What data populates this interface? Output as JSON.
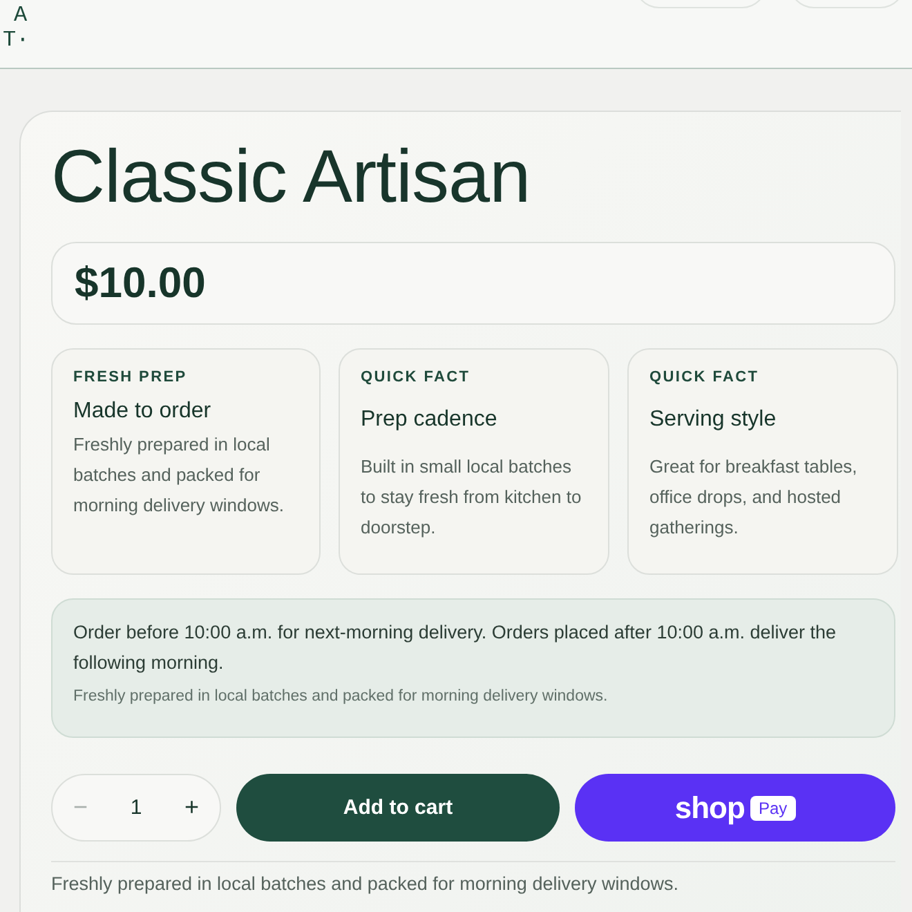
{
  "header": {
    "logo_lines": [
      "A",
      "T·"
    ]
  },
  "product": {
    "title": "Classic Artisan",
    "price": "$10.00"
  },
  "features": [
    {
      "eyebrow": "FRESH PREP",
      "title": "Made to order",
      "text": "Freshly prepared in local batches and packed for morning delivery windows."
    },
    {
      "eyebrow": "QUICK FACT",
      "title": "Prep cadence",
      "text": "Built in small local batches to stay fresh from kitchen to doorstep."
    },
    {
      "eyebrow": "QUICK FACT",
      "title": "Serving style",
      "text": "Great for breakfast tables, office drops, and hosted gatherings."
    }
  ],
  "notice": {
    "text": "Order before 10:00 a.m. for next-morning delivery. Orders placed after 10:00 a.m. deliver the following morning.",
    "subtext": "Freshly prepared in local batches and packed for morning delivery windows."
  },
  "quantity": {
    "minus": "−",
    "value": "1",
    "plus": "+"
  },
  "add_to_cart": "Add to cart",
  "shop_pay": {
    "word": "shop",
    "badge": "Pay"
  },
  "description": "Freshly prepared in local batches and packed for morning delivery windows."
}
